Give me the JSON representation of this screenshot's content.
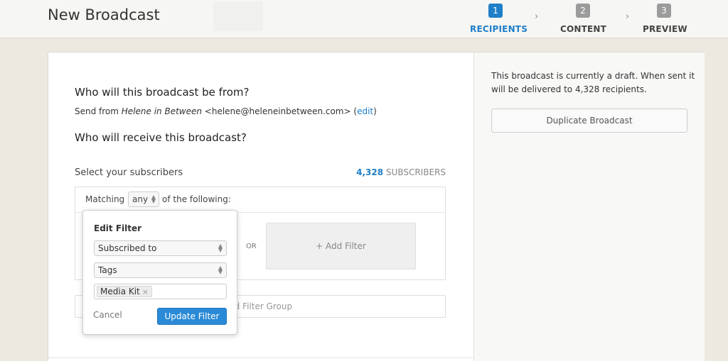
{
  "header": {
    "title": "New Broadcast",
    "steps": [
      {
        "num": "1",
        "label": "RECIPIENTS",
        "active": true
      },
      {
        "num": "2",
        "label": "CONTENT",
        "active": false
      },
      {
        "num": "3",
        "label": "PREVIEW",
        "active": false
      }
    ],
    "chevron": "›"
  },
  "main": {
    "from_heading": "Who will this broadcast be from?",
    "send_from_prefix": "Send from ",
    "sender_name": "Helene in Between",
    "sender_email": " <helene@heleneinbetween.com> ",
    "edit_open": "(",
    "edit_label": "edit",
    "edit_close": ")",
    "receive_heading": "Who will receive this broadcast?",
    "select_label": "Select your subscribers",
    "subscriber_count": "4,328",
    "subscriber_suffix": " SUBSCRIBERS",
    "matching_prefix": "Matching",
    "matching_value": "any",
    "matching_suffix": "of the following:",
    "or_label": "OR",
    "add_filter_label": "+ Add Filter",
    "add_filter_group_label": "dd Filter Group"
  },
  "popover": {
    "title": "Edit Filter",
    "field_select": "Subscribed to",
    "type_select": "Tags",
    "tags": [
      "Media Kit"
    ],
    "tag_remove": "×",
    "cancel_label": "Cancel",
    "update_label": "Update Filter"
  },
  "sidebar": {
    "status_text": "This broadcast is currently a draft. When sent it will be delivered to 4,328 recipients.",
    "duplicate_label": "Duplicate Broadcast"
  },
  "colors": {
    "accent": "#1f7ec8",
    "button": "#2a8ad6",
    "background": "#ede9e0"
  }
}
